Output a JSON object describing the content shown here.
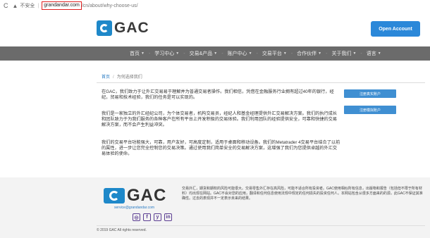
{
  "browser": {
    "insecure_label": "不安全",
    "host": "grandandar.com",
    "path": "/cn/about/why-choose-us/"
  },
  "header": {
    "logo_text": "GAC",
    "open_account_label": "Open Account"
  },
  "nav": {
    "items": [
      {
        "label": "首页",
        "has_caret": true
      },
      {
        "label": "学习中心",
        "has_caret": true
      },
      {
        "label": "交易&产品",
        "has_caret": true
      },
      {
        "label": "账户中心",
        "has_caret": true
      },
      {
        "label": "交易平台",
        "has_caret": true
      },
      {
        "label": "合作伙伴",
        "has_caret": true
      },
      {
        "label": "关于我们",
        "has_caret": true
      },
      {
        "label": "语言",
        "has_caret": true
      }
    ]
  },
  "breadcrumb": {
    "home": "首页",
    "separator": "/",
    "current": "为何选择我们"
  },
  "content": {
    "paragraphs": [
      "在GAC，我们致力于让外汇交易易于理解并为普通交易者操作。我们相信，凭借在金融服务行业拥有超过40年的银行，经纪，贸易和技术经验，我们的任务是可以实现的。",
      "我们是一家独立的外汇经纪公司，为个体交易者，机构交易员，经纪人和基金经理提供外汇交易解决方案。我们的执行成长和团队致力于为我们服务的各种客户在所有平台上开发积极的交易体验。我们利用团队的经验提供安全，可靠和快捷的交易解决方案，而不会产生利益冲突。",
      "我们的交易平台功能强大，可靠，用户友好，可高度定制，适用于桌面和移动设备。我们的Metatrader 4交易平台结合了以前的属性，进一步让您完全控制您的交易决策。通过使用我们简单安全的交易解决方案，这增强了我们为您提供卓越的外汇交易体验的使命。"
    ],
    "cta_real": "注册真实账户",
    "cta_demo": "注册模拟账户"
  },
  "footer": {
    "logo_text": "GAC",
    "email": "service@grandandar.com",
    "social": [
      {
        "icon": "instagram-icon",
        "glyph": "◎"
      },
      {
        "icon": "facebook-icon",
        "glyph": "f"
      },
      {
        "icon": "twitter-icon",
        "glyph": "y"
      },
      {
        "icon": "linkedin-icon",
        "glyph": "in"
      }
    ],
    "disclaimer": "交易外汇，期货和期权的风险可能很大。交易零售外汇存在高风险，可能不适合所有投资者。GAC使用相似所有信息，出版物和报告（包括但不限于所有材料）均出现在网站。GAC不会对您的应用，翻译和任何信息使用法规中规定的任何损失的投资任何人。本网站包含从很多方面来的的源，此GAC不保证其准确性。过去的表现并不一定表示未来的结果。",
    "copyright": "© 2019 GAC All rights reserved."
  }
}
